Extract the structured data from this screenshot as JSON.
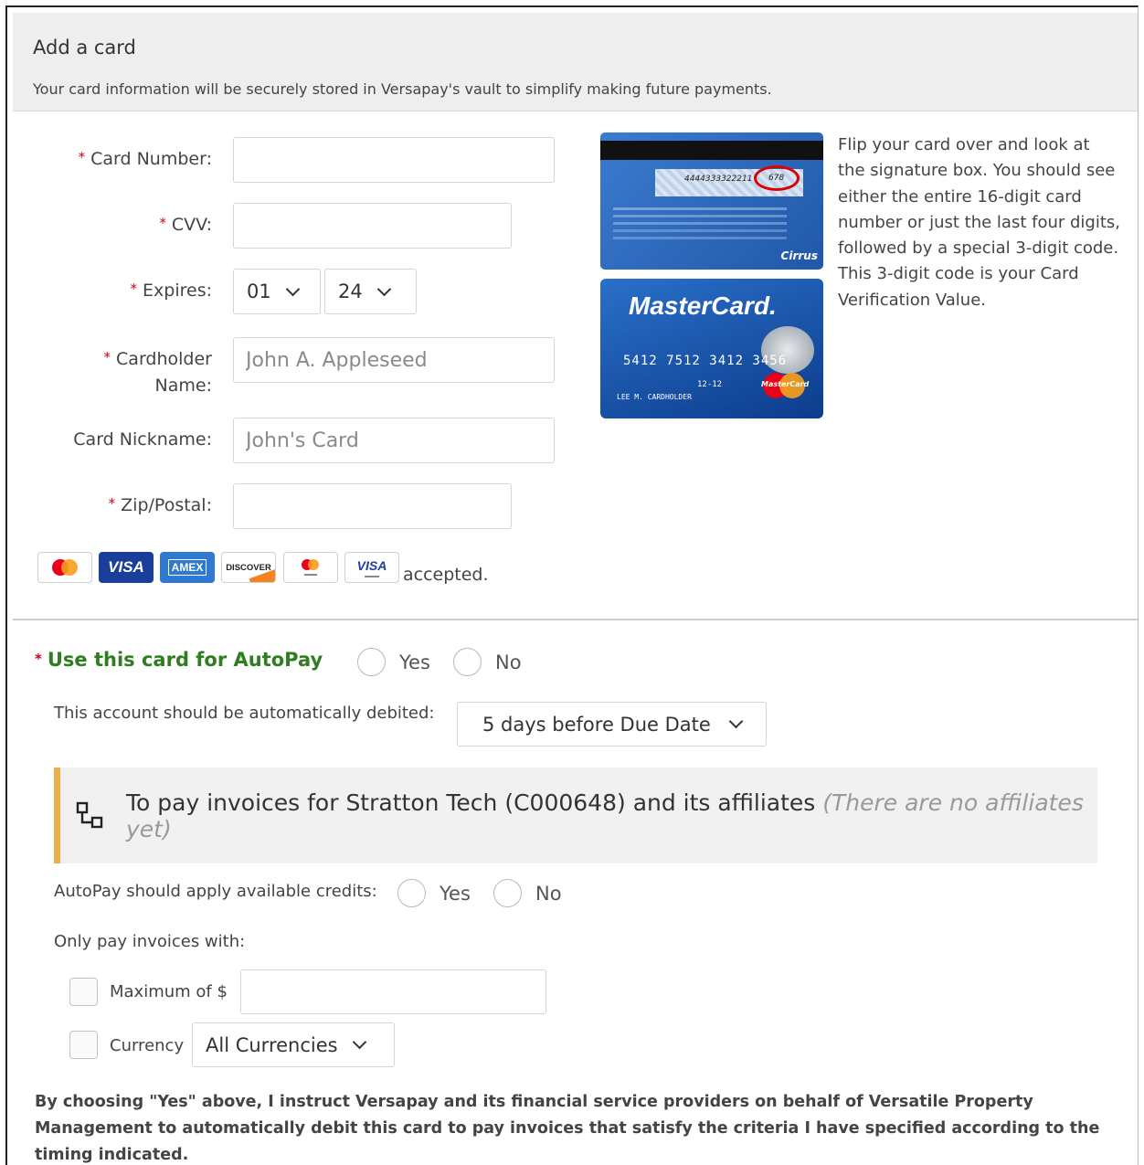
{
  "header": {
    "title": "Add a card",
    "subtitle": "Your card information will be securely stored in Versapay's vault to simplify making future payments."
  },
  "form": {
    "required_mark": "*",
    "card_number_label": "Card Number:",
    "cvv_label": "CVV:",
    "expires_label": "Expires:",
    "expires_month": "01",
    "expires_year": "24",
    "cardholder_label_1": "Cardholder",
    "cardholder_label_2": "Name:",
    "cardholder_placeholder": "John A. Appleseed",
    "nickname_label": "Card Nickname:",
    "nickname_placeholder": "John's Card",
    "zip_label": "Zip/Postal:",
    "accepted_text": "accepted."
  },
  "card_images": {
    "back_card_number": "4444333322211",
    "back_cvv": "678",
    "back_brand": "Cirrus",
    "front_brand": "MasterCard.",
    "front_number": "5412  7512  3412  3456",
    "front_expiry": "12-12",
    "front_holder": "LEE M. CARDHOLDER",
    "front_logo_text": "MasterCard"
  },
  "help_text": "Flip your card over and look at the signature box. You should see either the entire 16-digit card number or just the last four digits, followed by a special 3-digit code. This 3-digit code is your Card Verification Value.",
  "accepted_cards": [
    {
      "name": "mastercard",
      "label": ""
    },
    {
      "name": "visa",
      "label": "VISA"
    },
    {
      "name": "amex",
      "label": "AMEX"
    },
    {
      "name": "discover",
      "label": "DISCOVER"
    },
    {
      "name": "mastercard-debit",
      "label": ""
    },
    {
      "name": "visa-debit",
      "label": "VISA"
    }
  ],
  "autopay": {
    "title": "Use this card for AutoPay",
    "yes": "Yes",
    "no": "No",
    "debit_label": "This account should be automatically debited:",
    "debit_value": "5 days before Due Date",
    "notice_main": "To pay invoices for Stratton Tech (C000648) and its affiliates ",
    "notice_italic": "(There are no affiliates yet)",
    "credits_label": "AutoPay should apply available credits:",
    "credits_yes": "Yes",
    "credits_no": "No",
    "only_pay_label": "Only pay invoices with:",
    "maximum_label": "Maximum of $",
    "currency_label": "Currency",
    "currency_value": "All Currencies",
    "legal": "By choosing \"Yes\" above, I instruct Versapay and its financial service providers on behalf of Versatile Property Management to automatically debit this card to pay invoices that satisfy the criteria I have specified according to the timing indicated."
  },
  "colors": {
    "required": "#d0021b",
    "autopay_title": "#2e7d1f",
    "notice_accent": "#f0ad4e",
    "header_bg": "#eeeeee",
    "mastercard_blue": "#1565c0"
  }
}
